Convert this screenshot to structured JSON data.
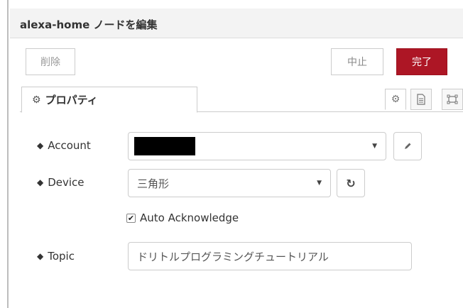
{
  "header": {
    "title": "alexa-home ノードを編集"
  },
  "buttons": {
    "delete": "削除",
    "cancel": "中止",
    "done": "完了"
  },
  "tabs": {
    "properties": "プロパティ"
  },
  "form": {
    "account": {
      "label": "Account",
      "value": ""
    },
    "device": {
      "label": "Device",
      "value": "三角形"
    },
    "auto_ack": {
      "label": "Auto Acknowledge",
      "checked": true
    },
    "topic": {
      "label": "Topic",
      "value": "ドリトルプログラミングチュートリアル"
    }
  },
  "colors": {
    "accent": "#ad1625",
    "header_bg": "#f3f3f3",
    "border": "#cccccc"
  },
  "icons": [
    "gear-icon",
    "document-icon",
    "frame-icon",
    "tag-icon",
    "pencil-icon",
    "refresh-icon",
    "caret-down-icon",
    "checkmark-icon"
  ]
}
